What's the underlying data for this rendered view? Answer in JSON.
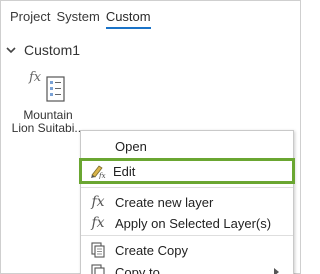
{
  "tabs": [
    "Project",
    "System",
    "Custom"
  ],
  "group": {
    "title": "Custom1"
  },
  "item": {
    "label_line1": "Mountain",
    "label_line2": "Lion Suitabi..."
  },
  "menu": {
    "open": "Open",
    "edit": "Edit",
    "create_new_layer": "Create new layer",
    "apply_selected": "Apply on Selected Layer(s)",
    "create_copy": "Create Copy",
    "copy_to": "Copy to"
  },
  "colors": {
    "tab_underline": "#1a73c8",
    "highlight": "#6aa631"
  }
}
